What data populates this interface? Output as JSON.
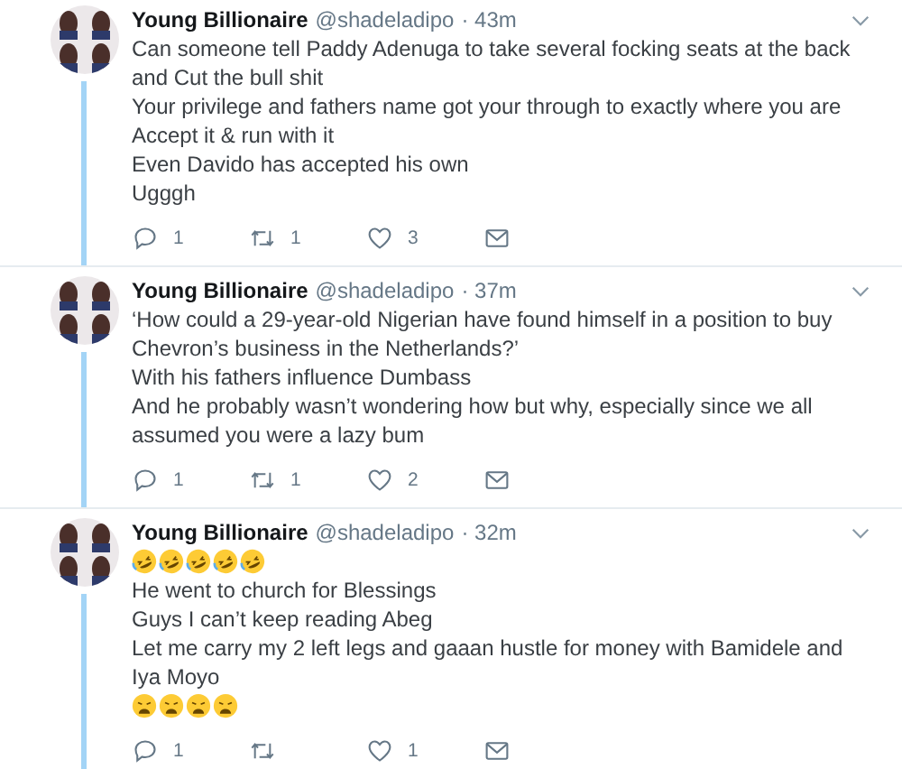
{
  "tweets": [
    {
      "name": "Young Billionaire",
      "handle": "@shadeladipo",
      "time": "· 43m",
      "thread_line": true,
      "lines": [
        {
          "kind": "text",
          "text": "Can someone tell Paddy Adenuga to take several focking seats at the back and Cut the bull shit"
        },
        {
          "kind": "text",
          "text": "Your privilege and fathers name got your through to exactly where you are"
        },
        {
          "kind": "text",
          "text": "Accept it & run with it"
        },
        {
          "kind": "text",
          "text": "Even Davido has accepted his own"
        },
        {
          "kind": "text",
          "text": "Ugggh"
        }
      ],
      "replies": "1",
      "retweets": "1",
      "likes": "3"
    },
    {
      "name": "Young Billionaire",
      "handle": "@shadeladipo",
      "time": "· 37m",
      "thread_line": true,
      "lines": [
        {
          "kind": "text",
          "text": "‘How could a 29-year-old Nigerian have found himself in a position to buy Chevron’s business in the Netherlands?’"
        },
        {
          "kind": "text",
          "text": "With his fathers influence Dumbass"
        },
        {
          "kind": "text",
          "text": "And he probably wasn’t wondering how but why, especially since we all assumed you were a lazy bum"
        }
      ],
      "replies": "1",
      "retweets": "1",
      "likes": "2"
    },
    {
      "name": "Young Billionaire",
      "handle": "@shadeladipo",
      "time": "· 32m",
      "thread_line": true,
      "lines": [
        {
          "kind": "emoji",
          "emoji": [
            {
              "kind": "rofl"
            },
            {
              "kind": "rofl"
            },
            {
              "kind": "rofl"
            },
            {
              "kind": "rofl"
            },
            {
              "kind": "rofl"
            }
          ]
        },
        {
          "kind": "text",
          "text": "He went to church for Blessings"
        },
        {
          "kind": "text",
          "text": "Guys I can’t keep reading Abeg"
        },
        {
          "kind": "text",
          "text": "Let me carry my 2 left legs and gaaan hustle for money with Bamidele and Iya Moyo"
        },
        {
          "kind": "emoji",
          "emoji": [
            {
              "kind": "weary"
            },
            {
              "kind": "weary"
            },
            {
              "kind": "weary"
            },
            {
              "kind": "weary"
            }
          ]
        }
      ],
      "replies": "1",
      "likes": "1"
    }
  ]
}
